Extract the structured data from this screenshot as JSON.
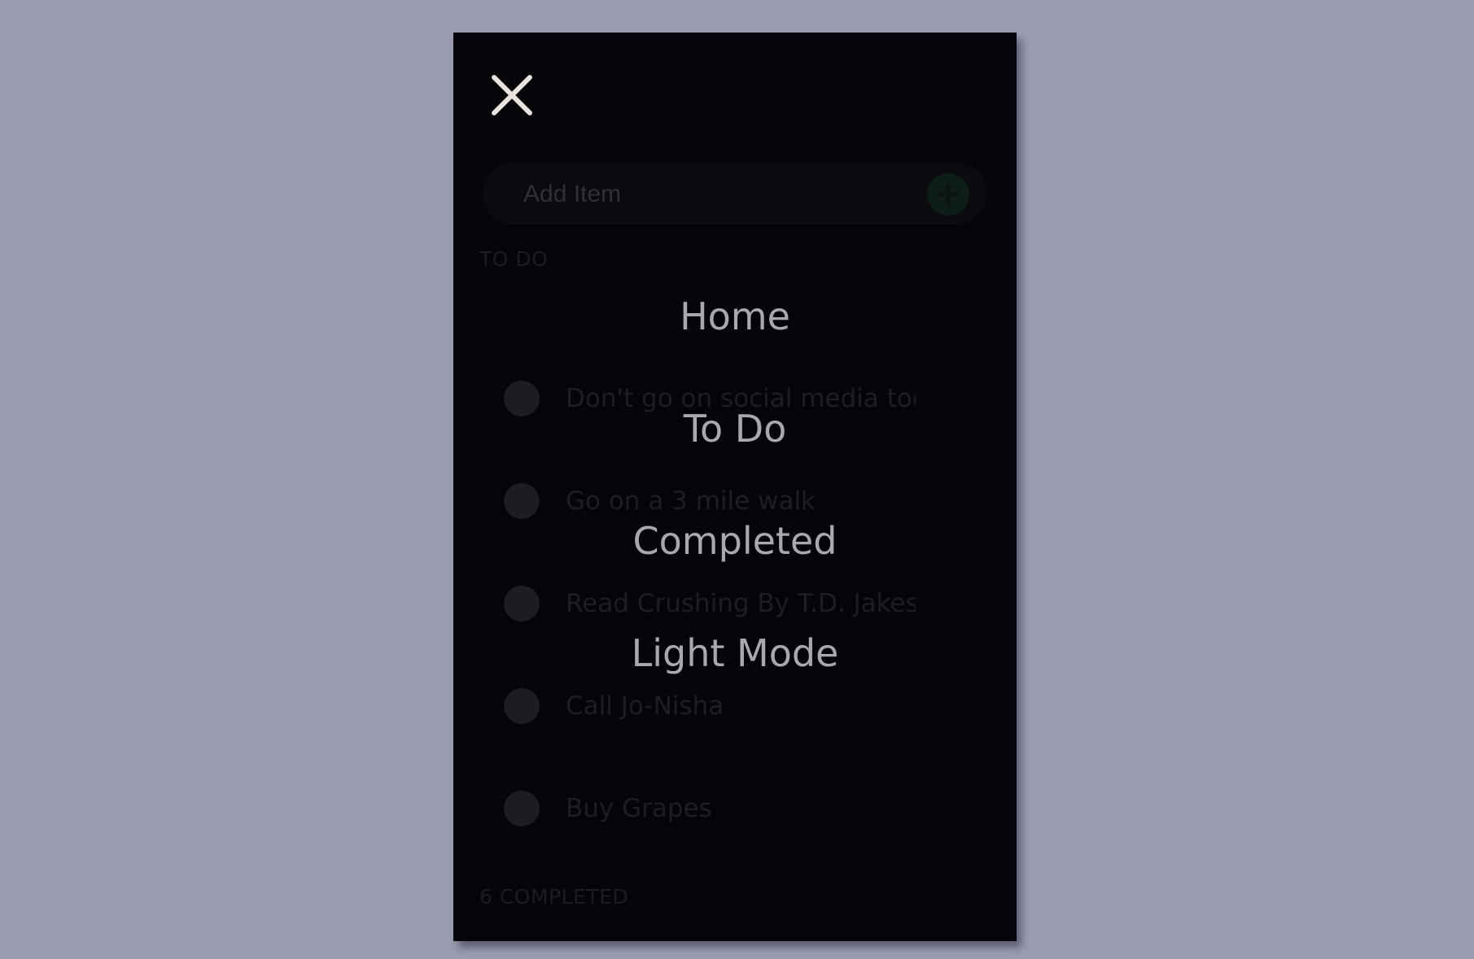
{
  "add_item": {
    "placeholder": "Add Item",
    "button_icon": "plus-icon"
  },
  "todo_section": {
    "label": "TO DO",
    "items": [
      "Don't go on social media today",
      "Go on a 3 mile walk",
      "Read Crushing By T.D. Jakes",
      "Call Jo-Nisha",
      "Buy Grapes"
    ]
  },
  "completed_section": {
    "label": "6 COMPLETED"
  },
  "menu": {
    "close_icon": "close-icon",
    "items": [
      "Home",
      "To Do",
      "Completed",
      "Light Mode"
    ]
  },
  "colors": {
    "background": "#9c9db3",
    "panel": "#050509",
    "menu_text": "#a9a9ad",
    "close_icon": "#e9e2df"
  }
}
